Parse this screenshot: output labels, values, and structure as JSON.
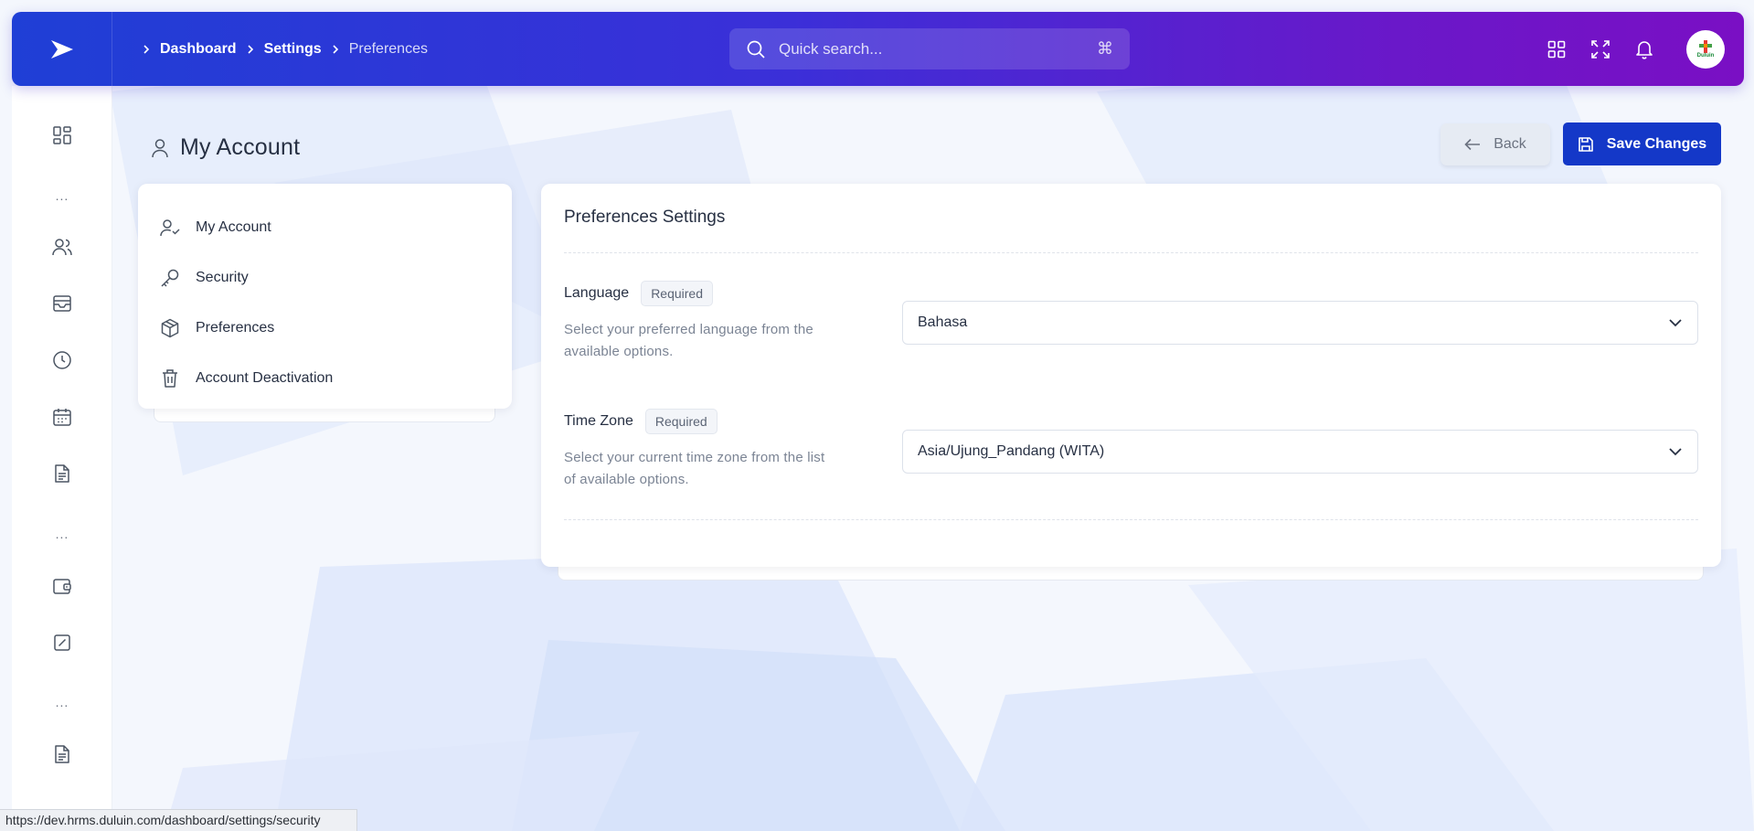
{
  "header": {
    "breadcrumb": [
      "Dashboard",
      "Settings",
      "Preferences"
    ],
    "search_placeholder": "Quick search...",
    "search_shortcut": "⌘",
    "avatar_text": "Duluin"
  },
  "page": {
    "title": "My Account",
    "back_label": "Back",
    "save_label": "Save Changes"
  },
  "sidebar": {
    "icons": [
      "grid-icon",
      "users-icon",
      "inbox-icon",
      "clock-icon",
      "calendar-icon",
      "document-icon",
      "wallet-icon",
      "percent-icon",
      "file-icon"
    ],
    "separator": "..."
  },
  "account_menu": {
    "items": [
      {
        "label": "My Account",
        "icon": "user-check-icon"
      },
      {
        "label": "Security",
        "icon": "key-icon"
      },
      {
        "label": "Preferences",
        "icon": "package-icon"
      },
      {
        "label": "Account Deactivation",
        "icon": "trash-icon"
      }
    ]
  },
  "preferences": {
    "title": "Preferences Settings",
    "language": {
      "label": "Language",
      "badge": "Required",
      "help": "Select your preferred language from the available options.",
      "value": "Bahasa"
    },
    "timezone": {
      "label": "Time Zone",
      "badge": "Required",
      "help": "Select your current time zone from the list of available options.",
      "value": "Asia/Ujung_Pandang (WITA)"
    }
  },
  "status_bar": {
    "url": "https://dev.hrms.duluin.com/dashboard/settings/security"
  },
  "colors": {
    "primary": "#1438c8",
    "header_gradient_start": "#1f3fd6",
    "header_gradient_end": "#7a0fc4",
    "page_bg": "#f4f7fd"
  }
}
